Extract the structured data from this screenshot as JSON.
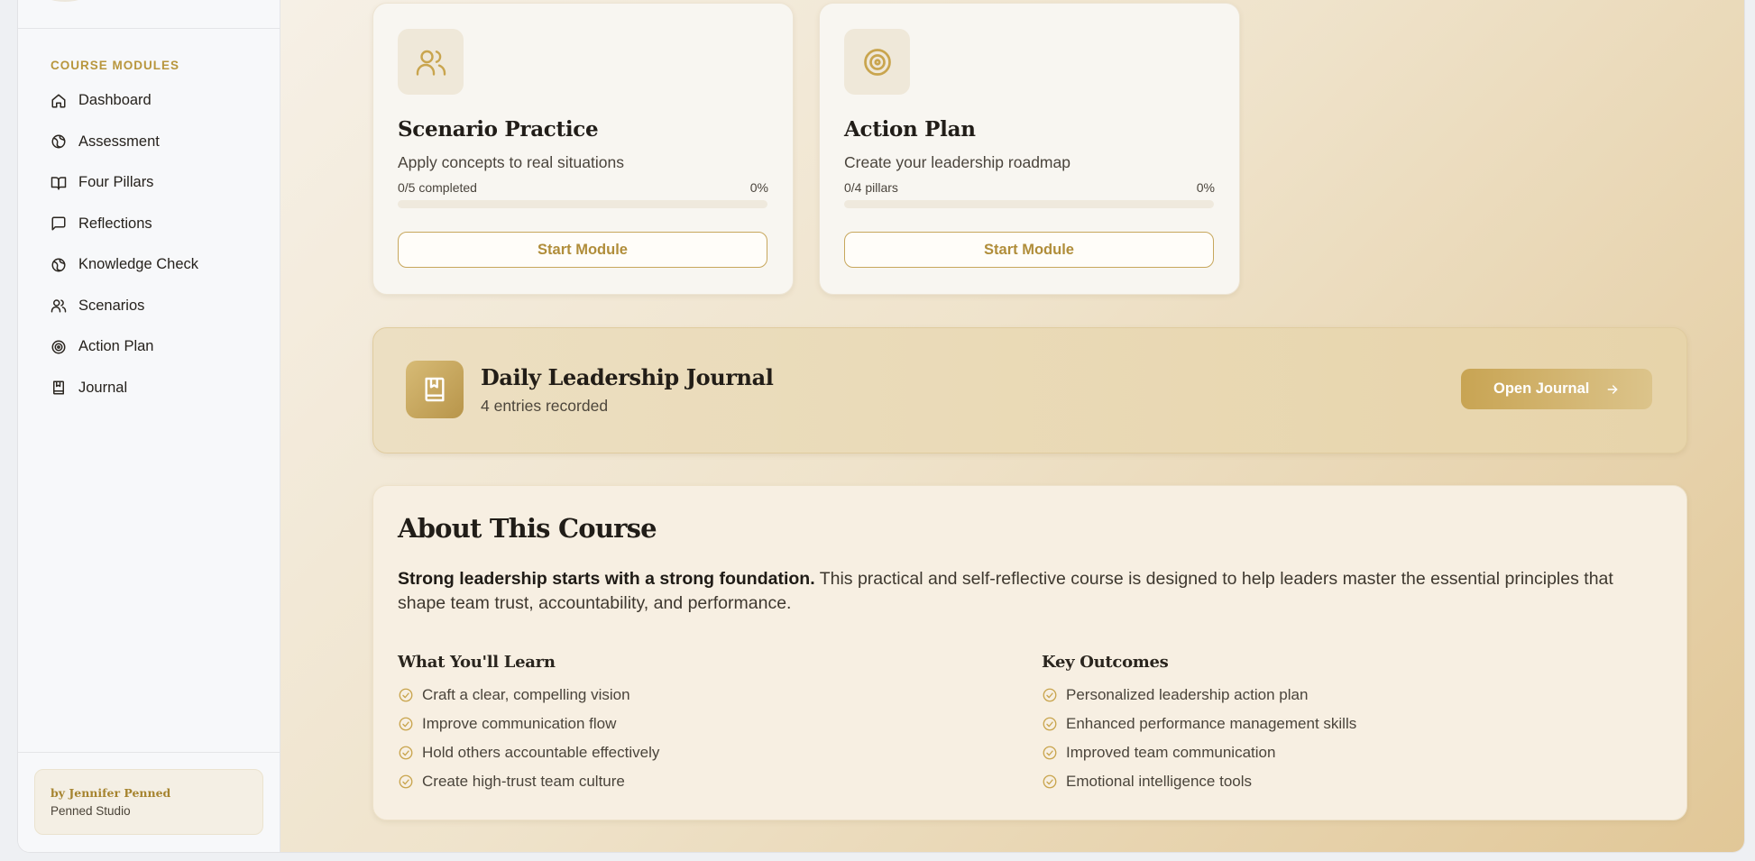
{
  "sidebar": {
    "section_label": "COURSE MODULES",
    "items": [
      {
        "label": "Dashboard",
        "icon": "home-icon"
      },
      {
        "label": "Assessment",
        "icon": "globe-icon"
      },
      {
        "label": "Four Pillars",
        "icon": "book-open-icon"
      },
      {
        "label": "Reflections",
        "icon": "message-square-icon"
      },
      {
        "label": "Knowledge Check",
        "icon": "globe-icon"
      },
      {
        "label": "Scenarios",
        "icon": "users-icon"
      },
      {
        "label": "Action Plan",
        "icon": "target-icon"
      },
      {
        "label": "Journal",
        "icon": "notebook-icon"
      }
    ],
    "author": {
      "by": "by Jennifer Penned",
      "studio": "Penned Studio"
    }
  },
  "modules": [
    {
      "title": "Scenario Practice",
      "description": "Apply concepts to real situations",
      "progress_label": "0/5 completed",
      "progress_pct": "0%",
      "progress": 0,
      "button": "Start Module",
      "icon": "users-icon"
    },
    {
      "title": "Action Plan",
      "description": "Create your leadership roadmap",
      "progress_label": "0/4 pillars",
      "progress_pct": "0%",
      "progress": 0,
      "button": "Start Module",
      "icon": "target-icon"
    }
  ],
  "journal": {
    "title": "Daily Leadership Journal",
    "subtitle": "4 entries recorded",
    "button": "Open Journal",
    "icon": "bookmark-book-icon"
  },
  "about": {
    "title": "About This Course",
    "intro_bold": "Strong leadership starts with a strong foundation.",
    "intro_rest": " This practical and self-reflective course is designed to help leaders master the essential principles that shape team trust, accountability, and performance.",
    "learn_title": "What You'll Learn",
    "learn_items": [
      "Craft a clear, compelling vision",
      "Improve communication flow",
      "Hold others accountable effectively",
      "Create high-trust team culture"
    ],
    "outcomes_title": "Key Outcomes",
    "outcomes_items": [
      "Personalized leadership action plan",
      "Enhanced performance management skills",
      "Improved team communication",
      "Emotional intelligence tools"
    ]
  },
  "colors": {
    "accent": "#c9a54e",
    "accent_text": "#b08d3a",
    "text_dark": "#211d18"
  }
}
